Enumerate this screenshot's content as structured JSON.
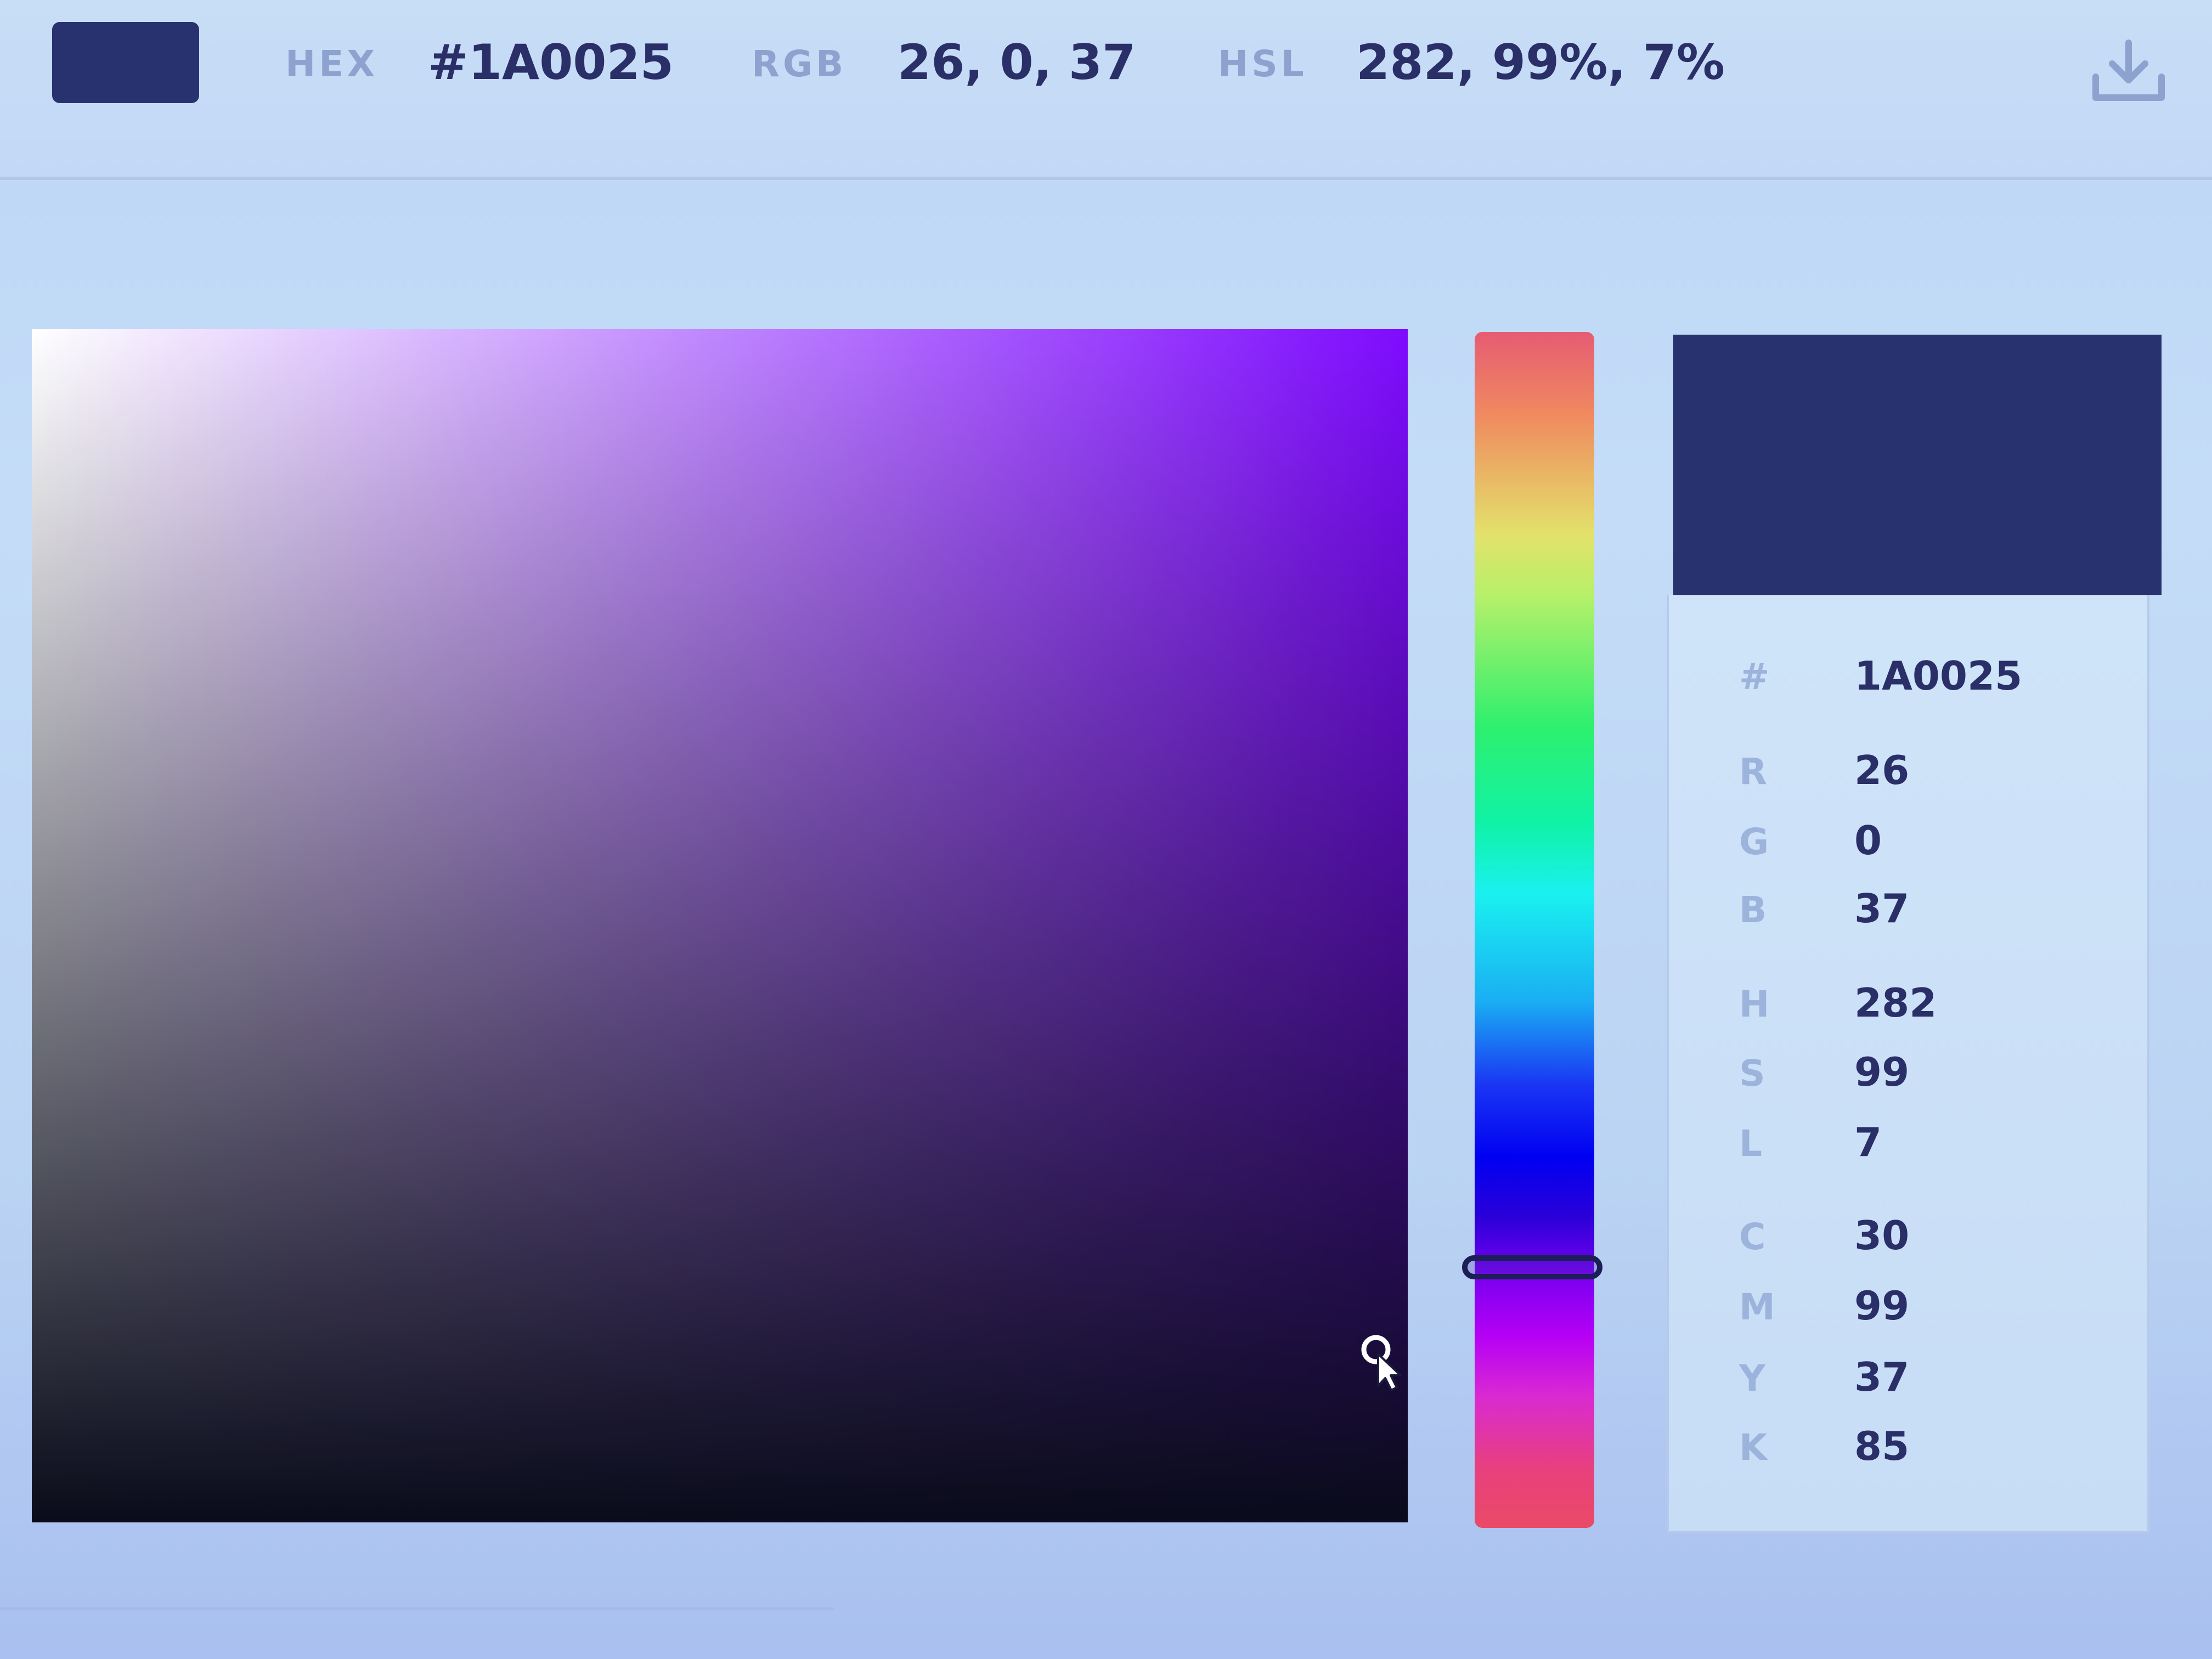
{
  "selected_color": "#1A0025",
  "hue_color": "#7a00ff",
  "preview_color": "#27326e",
  "topbar": {
    "hex_label": "HEX",
    "hex_value": "#1A0025",
    "rgb_label": "RGB",
    "rgb_value": "26, 0, 37",
    "hsl_label": "HSL",
    "hsl_value": "282, 99%, 7%",
    "download_icon": "download-icon"
  },
  "hue_slider": {
    "hue": 282
  },
  "values": {
    "hash": {
      "label": "#",
      "value": "1A0025"
    },
    "r": {
      "label": "R",
      "value": "26"
    },
    "g": {
      "label": "G",
      "value": "0"
    },
    "b": {
      "label": "B",
      "value": "37"
    },
    "h": {
      "label": "H",
      "value": "282"
    },
    "s": {
      "label": "S",
      "value": "99"
    },
    "l": {
      "label": "L",
      "value": "7"
    },
    "c": {
      "label": "C",
      "value": "30"
    },
    "m": {
      "label": "M",
      "value": "99"
    },
    "y": {
      "label": "Y",
      "value": "37"
    },
    "k": {
      "label": "K",
      "value": "85"
    }
  }
}
